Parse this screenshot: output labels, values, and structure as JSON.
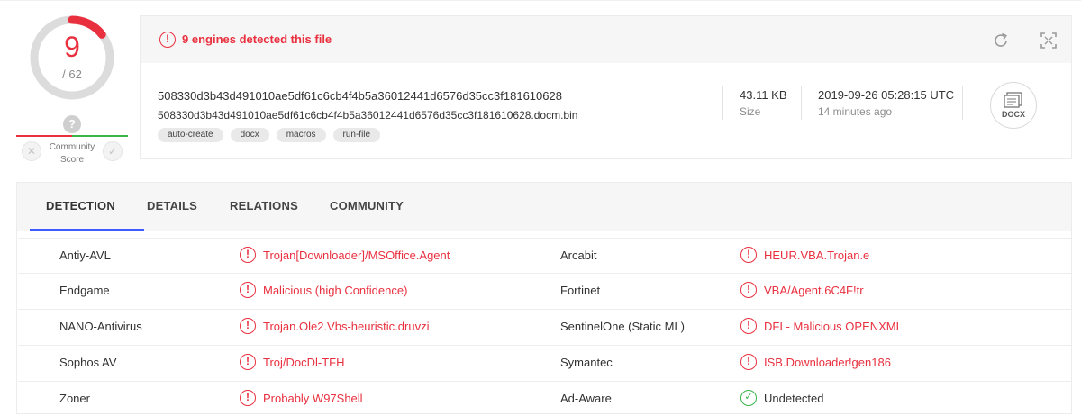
{
  "colors": {
    "malicious": "#e9303f",
    "clean": "#3ab54a",
    "accent": "#3d5afe"
  },
  "score": {
    "detections": "9",
    "total": "/ 62",
    "detection_fraction": 0.145,
    "community_label": "Community Score",
    "help_glyph": "?"
  },
  "summary": {
    "alert": "9 engines detected this file",
    "hash": "508330d3b43d491010ae5df61c6cb4f4b5a36012441d6576d35cc3f181610628",
    "filename": "508330d3b43d491010ae5df61c6cb4f4b5a36012441d6576d35cc3f181610628.docm.bin",
    "tags": [
      "auto-create",
      "docx",
      "macros",
      "run-file"
    ],
    "size_value": "43.11 KB",
    "size_label": "Size",
    "date_value": "2019-09-26 05:28:15 UTC",
    "date_relative": "14 minutes ago",
    "filetype": "DOCX",
    "icons": [
      "reload-icon",
      "expand-icon"
    ]
  },
  "tabs": [
    {
      "label": "DETECTION",
      "active": true
    },
    {
      "label": "DETAILS",
      "active": false
    },
    {
      "label": "RELATIONS",
      "active": false
    },
    {
      "label": "COMMUNITY",
      "active": false
    }
  ],
  "detections": [
    {
      "left": {
        "engine": "Antiy-AVL",
        "result": "Trojan[Downloader]/MSOffice.Agent",
        "status": "malicious"
      },
      "right": {
        "engine": "Arcabit",
        "result": "HEUR.VBA.Trojan.e",
        "status": "malicious"
      }
    },
    {
      "left": {
        "engine": "Endgame",
        "result": "Malicious (high Confidence)",
        "status": "malicious"
      },
      "right": {
        "engine": "Fortinet",
        "result": "VBA/Agent.6C4F!tr",
        "status": "malicious"
      }
    },
    {
      "left": {
        "engine": "NANO-Antivirus",
        "result": "Trojan.Ole2.Vbs-heuristic.druvzi",
        "status": "malicious"
      },
      "right": {
        "engine": "SentinelOne (Static ML)",
        "result": "DFI - Malicious OPENXML",
        "status": "malicious"
      }
    },
    {
      "left": {
        "engine": "Sophos AV",
        "result": "Troj/DocDl-TFH",
        "status": "malicious"
      },
      "right": {
        "engine": "Symantec",
        "result": "ISB.Downloader!gen186",
        "status": "malicious"
      }
    },
    {
      "left": {
        "engine": "Zoner",
        "result": "Probably W97Shell",
        "status": "malicious"
      },
      "right": {
        "engine": "Ad-Aware",
        "result": "Undetected",
        "status": "clean"
      }
    }
  ]
}
